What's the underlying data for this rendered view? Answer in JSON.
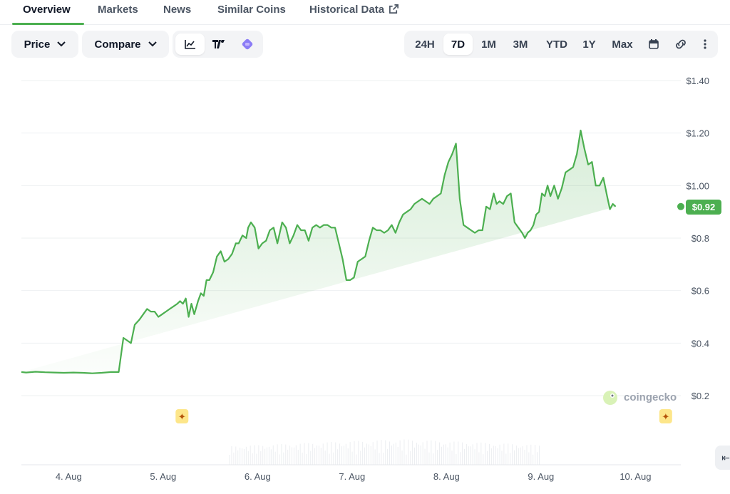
{
  "tabs": [
    {
      "label": "Overview",
      "active": true
    },
    {
      "label": "Markets"
    },
    {
      "label": "News"
    },
    {
      "label": "Similar Coins"
    },
    {
      "label": "Historical Data",
      "icon": "external-link-icon"
    }
  ],
  "toolbar": {
    "price_label": "Price",
    "compare_label": "Compare",
    "view_icons": [
      "line-chart-icon",
      "tradingview-icon",
      "candlestick-icon"
    ],
    "ranges": [
      "24H",
      "7D",
      "1M",
      "3M",
      "YTD",
      "1Y",
      "Max"
    ],
    "selected_range": "7D",
    "extra_icons": [
      "calendar-icon",
      "link-icon",
      "more-vertical-icon"
    ]
  },
  "watermark": "coingecko",
  "current_price_label": "$0.92",
  "colors": {
    "line": "#4caf50",
    "badge": "#4caf50",
    "tab_underline": "#4caf50",
    "marker": "#fde68a"
  },
  "chart_data": {
    "type": "area",
    "x_ticks": [
      "4. Aug",
      "5. Aug",
      "6. Aug",
      "7. Aug",
      "8. Aug",
      "9. Aug",
      "10. Aug"
    ],
    "y_ticks": [
      "$1.40",
      "$1.20",
      "$1.00",
      "$0.8",
      "$0.6",
      "$0.4",
      "$0.2"
    ],
    "ylim": [
      0.2,
      1.4
    ],
    "xlim": [
      3.5,
      10.48
    ],
    "grid": true,
    "x": [
      3.5,
      3.55,
      3.65,
      3.75,
      3.85,
      3.95,
      4.05,
      4.15,
      4.25,
      4.35,
      4.45,
      4.5,
      4.53,
      4.58,
      4.62,
      4.66,
      4.7,
      4.75,
      4.79,
      4.83,
      4.87,
      4.91,
      4.95,
      4.99,
      5.03,
      5.07,
      5.11,
      5.15,
      5.18,
      5.21,
      5.24,
      5.27,
      5.3,
      5.33,
      5.37,
      5.4,
      5.43,
      5.46,
      5.49,
      5.53,
      5.57,
      5.61,
      5.65,
      5.69,
      5.73,
      5.77,
      5.8,
      5.84,
      5.88,
      5.9,
      5.93,
      5.97,
      6.01,
      6.05,
      6.09,
      6.13,
      6.17,
      6.21,
      6.26,
      6.3,
      6.34,
      6.38,
      6.42,
      6.46,
      6.5,
      6.54,
      6.58,
      6.62,
      6.66,
      6.7,
      6.74,
      6.78,
      6.82,
      6.86,
      6.9,
      6.94,
      6.98,
      7.02,
      7.06,
      7.1,
      7.14,
      7.18,
      7.22,
      7.26,
      7.3,
      7.34,
      7.38,
      7.42,
      7.46,
      7.5,
      7.54,
      7.58,
      7.62,
      7.66,
      7.7,
      7.74,
      7.78,
      7.82,
      7.86,
      7.9,
      7.94,
      7.98,
      8.02,
      8.06,
      8.1,
      8.14,
      8.18,
      8.22,
      8.26,
      8.3,
      8.34,
      8.38,
      8.42,
      8.46,
      8.5,
      8.53,
      8.56,
      8.6,
      8.64,
      8.68,
      8.72,
      8.76,
      8.8,
      8.83,
      8.86,
      8.89,
      8.92,
      8.95,
      8.98,
      9.01,
      9.04,
      9.07,
      9.1,
      9.14,
      9.18,
      9.22,
      9.26,
      9.3,
      9.34,
      9.38,
      9.42,
      9.46,
      9.5,
      9.54,
      9.58,
      9.62,
      9.66,
      9.7,
      9.73,
      9.76,
      9.79,
      9.82,
      9.85,
      9.88,
      9.92,
      9.96,
      10.0,
      10.03,
      10.06,
      10.09,
      10.12,
      10.15,
      10.18,
      10.22,
      10.26,
      10.3,
      10.34,
      10.38,
      10.42,
      10.45
    ],
    "y": [
      0.29,
      0.288,
      0.291,
      0.289,
      0.288,
      0.287,
      0.288,
      0.287,
      0.285,
      0.287,
      0.29,
      0.29,
      0.29,
      0.42,
      0.41,
      0.4,
      0.47,
      0.49,
      0.51,
      0.53,
      0.52,
      0.52,
      0.5,
      0.51,
      0.52,
      0.53,
      0.54,
      0.55,
      0.56,
      0.55,
      0.57,
      0.5,
      0.55,
      0.51,
      0.56,
      0.59,
      0.58,
      0.64,
      0.64,
      0.67,
      0.73,
      0.75,
      0.71,
      0.72,
      0.74,
      0.78,
      0.78,
      0.81,
      0.8,
      0.84,
      0.86,
      0.84,
      0.76,
      0.78,
      0.79,
      0.83,
      0.84,
      0.78,
      0.86,
      0.84,
      0.78,
      0.81,
      0.85,
      0.83,
      0.83,
      0.79,
      0.84,
      0.85,
      0.84,
      0.85,
      0.85,
      0.84,
      0.84,
      0.78,
      0.72,
      0.64,
      0.64,
      0.65,
      0.71,
      0.72,
      0.73,
      0.79,
      0.84,
      0.83,
      0.83,
      0.82,
      0.83,
      0.85,
      0.82,
      0.86,
      0.89,
      0.9,
      0.91,
      0.93,
      0.94,
      0.95,
      0.94,
      0.93,
      0.95,
      0.96,
      0.97,
      1.04,
      1.09,
      1.12,
      1.16,
      0.95,
      0.85,
      0.84,
      0.83,
      0.82,
      0.83,
      0.83,
      0.92,
      0.91,
      0.97,
      0.93,
      0.94,
      0.93,
      0.96,
      0.97,
      0.86,
      0.84,
      0.82,
      0.8,
      0.82,
      0.83,
      0.85,
      0.89,
      0.9,
      0.97,
      0.96,
      1.0,
      0.96,
      1.0,
      0.95,
      0.99,
      1.05,
      1.06,
      1.07,
      1.12,
      1.21,
      1.14,
      1.08,
      1.09,
      1.0,
      1.0,
      1.03,
      0.96,
      0.91,
      0.93,
      0.92
    ],
    "volume_bars": true,
    "markers_x": [
      5.2,
      10.32
    ],
    "last_value": 0.92
  }
}
